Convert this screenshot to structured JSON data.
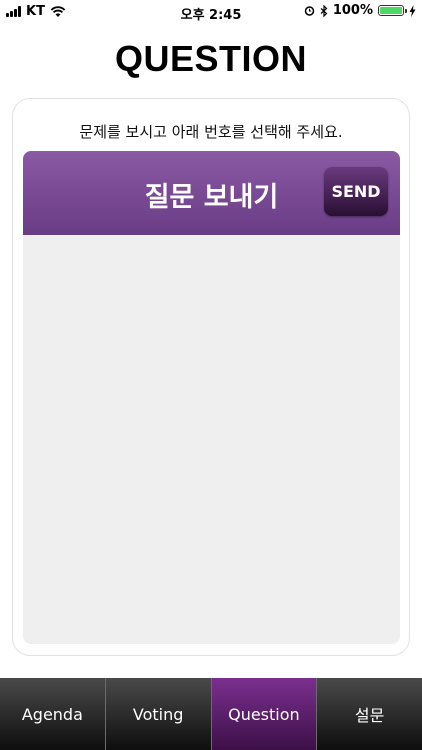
{
  "status_bar": {
    "carrier": "KT",
    "time": "오후 2:45",
    "battery": "100%",
    "battery_level": 1.0
  },
  "page": {
    "title": "QUESTION"
  },
  "card": {
    "instructions": "문제를 보시고 아래 번호를 선택해 주세요.",
    "header_title": "질문 보내기",
    "send_label": "SEND",
    "question_value": ""
  },
  "tabs": [
    {
      "label": "Agenda",
      "active": false
    },
    {
      "label": "Voting",
      "active": false
    },
    {
      "label": "Question",
      "active": true
    },
    {
      "label": "설문",
      "active": false
    }
  ],
  "colors": {
    "header": "#7b4d96",
    "active_tab": "#5a1f6b",
    "text_area": "#efefef"
  }
}
